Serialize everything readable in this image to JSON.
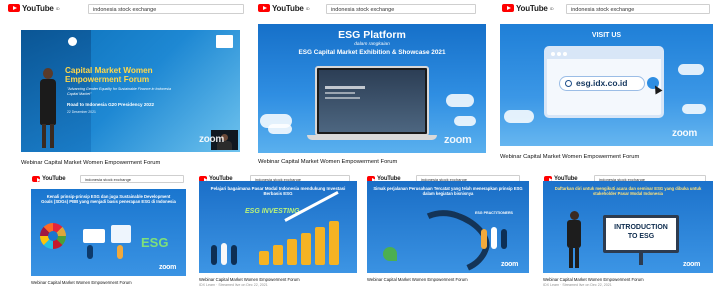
{
  "search_query": "indonesia stock exchange",
  "youtube_label": "YouTube",
  "youtube_region": "ID",
  "zoom_label": "zoom",
  "videos": [
    {
      "title": "Webinar Capital Market Women Empowerment Forum",
      "slide": {
        "heading": "Capital Market Women Empowerment Forum",
        "tagline": "\"Advancing Gender Equality for Sustainable Finance in Indonesia Capital Market\"",
        "event": "Road to Indonesia G20 Presidency 2022",
        "date": "22 Desember 2021"
      }
    },
    {
      "title": "Webinar Capital Market Women Empowerment Forum",
      "slide": {
        "heading": "ESG Platform",
        "sub1": "dalam rangkaian",
        "sub2": "ESG Capital Market Exhibition & Showcase 2021"
      }
    },
    {
      "title": "Webinar Capital Market Women Empowerment Forum",
      "slide": {
        "heading": "VISIT US",
        "url": "esg.idx.co.id"
      }
    },
    {
      "title": "Webinar Capital Market Women Empowerment Forum",
      "slide": {
        "heading": "Kenali prinsip-prinsip ESG dan juga Sustainable Development Goals (SDGs) PBB yang menjadi basis penerapan ESG di Indonesia",
        "badge": "ESG"
      }
    },
    {
      "title": "Webinar Capital Market Women Empowerment Forum",
      "meta": "IDX Learn · Streamed live on Dec 22, 2021",
      "slide": {
        "heading": "Pelajari bagaimana Pasar Modal Indonesia mendukung Investasi Berbasis ESG",
        "label": "ESG INVESTING"
      }
    },
    {
      "title": "Webinar Capital Market Women Empowerment Forum",
      "slide": {
        "heading": "Simak perjalanan Perusahaan Tercatat yang telah menerapkan prinsip ESG dalam kegiatan bisnisnya",
        "label": "ESG PRACTITIONERS"
      }
    },
    {
      "title": "Webinar Capital Market Women Empowerment Forum",
      "meta": "IDX Learn · Streamed live on Dec 22, 2021",
      "slide": {
        "heading": "Daftarkan diri untuk mengikuti acara dan seminar ESG yang dibuka untuk stakeholder Pasar Modal Indonesia",
        "label": "INTRODUCTION TO ESG"
      }
    }
  ]
}
